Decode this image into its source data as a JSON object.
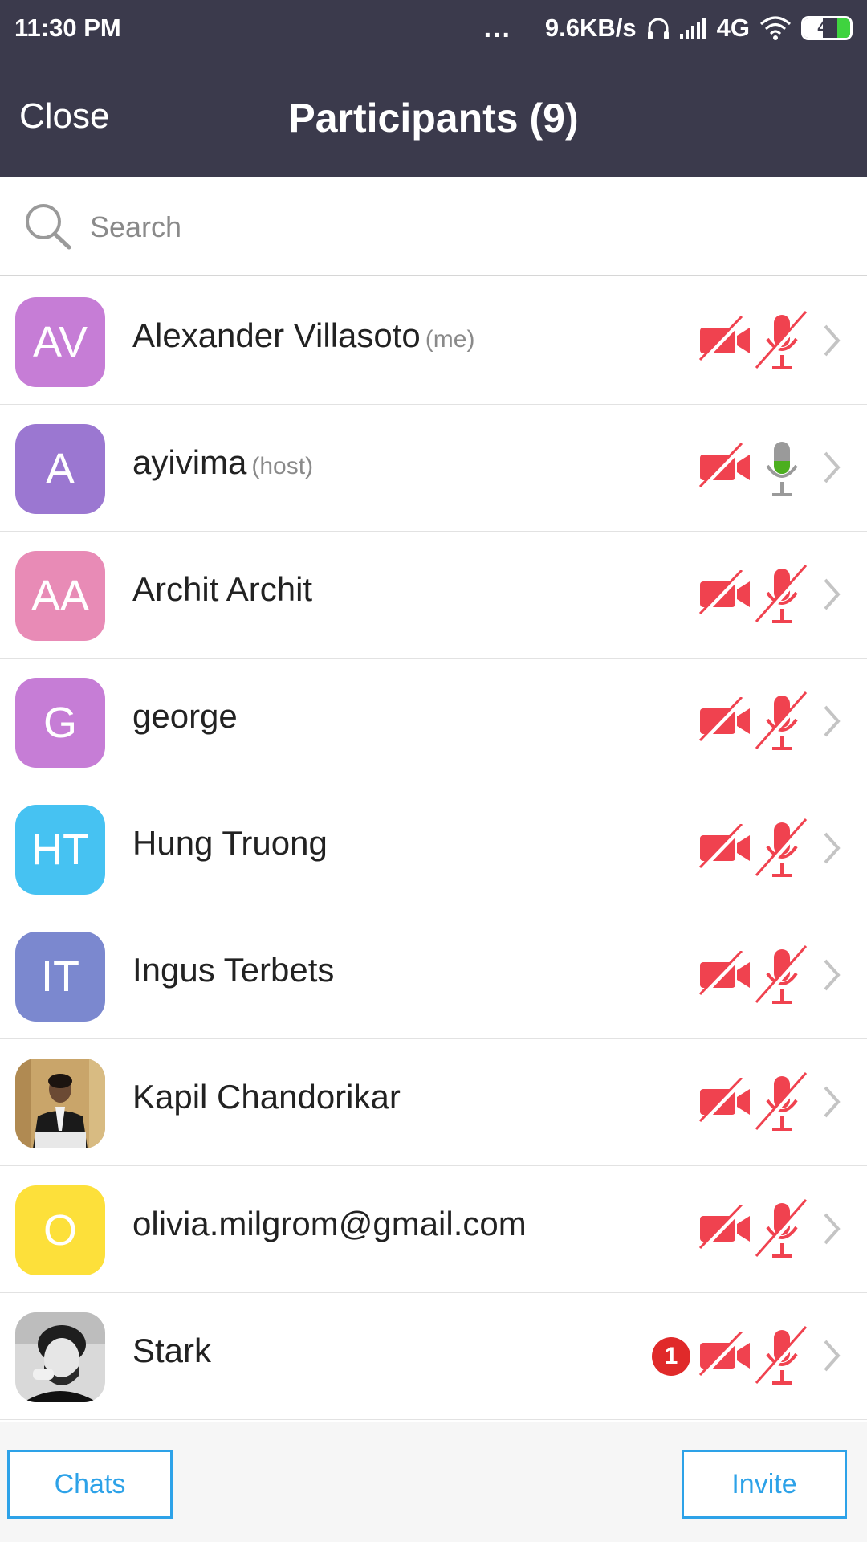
{
  "status_bar": {
    "time": "11:30 PM",
    "overflow": "...",
    "network_speed": "9.6KB/s",
    "network_type": "4G",
    "battery_level": "42",
    "battery_fraction": 0.42,
    "icons": [
      "headphones-icon",
      "signal-icon",
      "wifi-icon",
      "battery-icon"
    ]
  },
  "nav": {
    "close_label": "Close",
    "title": "Participants (9)"
  },
  "search": {
    "placeholder": "Search"
  },
  "colors": {
    "header_bg": "#3b3a4c",
    "muted_red": "#f0424f",
    "mic_on_green": "#4caf1f",
    "accent_blue": "#2da2e8",
    "badge_red": "#e02a2a"
  },
  "participants": [
    {
      "initials": "AV",
      "name": "Alexander Villasoto",
      "tag": "(me)",
      "avatar_color": "#c67dd6",
      "video": "off",
      "audio": "muted"
    },
    {
      "initials": "A",
      "name": "ayivima",
      "tag": "(host)",
      "avatar_color": "#9b77d1",
      "video": "off",
      "audio": "on"
    },
    {
      "initials": "AA",
      "name": "Archit Archit",
      "tag": "",
      "avatar_color": "#e88bb6",
      "video": "off",
      "audio": "muted"
    },
    {
      "initials": "G",
      "name": "george",
      "tag": "",
      "avatar_color": "#c67dd6",
      "video": "off",
      "audio": "muted"
    },
    {
      "initials": "HT",
      "name": "Hung Truong",
      "tag": "",
      "avatar_color": "#46c2f2",
      "video": "off",
      "audio": "muted"
    },
    {
      "initials": "IT",
      "name": "Ingus Terbets",
      "tag": "",
      "avatar_color": "#7b88cf",
      "video": "off",
      "audio": "muted"
    },
    {
      "initials": "",
      "name": "Kapil Chandorikar",
      "tag": "",
      "avatar_color": "photo",
      "video": "off",
      "audio": "muted"
    },
    {
      "initials": "O",
      "name": "olivia.milgrom@gmail.com",
      "tag": "",
      "avatar_color": "#fde03a",
      "video": "off",
      "audio": "muted"
    },
    {
      "initials": "",
      "name": "Stark",
      "tag": "",
      "avatar_color": "photo-bw",
      "video": "off",
      "audio": "muted",
      "badge": "1"
    }
  ],
  "footer": {
    "chats_label": "Chats",
    "invite_label": "Invite"
  }
}
